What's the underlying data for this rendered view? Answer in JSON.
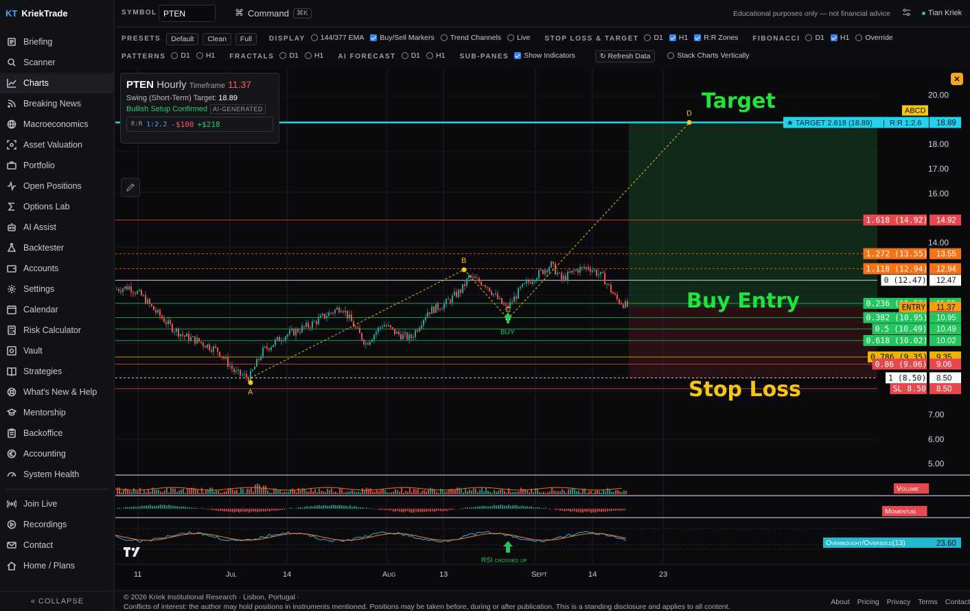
{
  "brand": {
    "logo": "KT",
    "name": "KriekTrade"
  },
  "sidebar": {
    "items": [
      {
        "label": "Briefing",
        "icon": "newspaper-icon"
      },
      {
        "label": "Scanner",
        "icon": "search-icon"
      },
      {
        "label": "Charts",
        "icon": "chart-line-icon",
        "active": true
      },
      {
        "label": "Breaking News",
        "icon": "rss-icon"
      },
      {
        "label": "Macroeconomics",
        "icon": "globe-icon"
      },
      {
        "label": "Asset Valuation",
        "icon": "scan-icon"
      },
      {
        "label": "Portfolio",
        "icon": "briefcase-icon"
      },
      {
        "label": "Open Positions",
        "icon": "pulse-icon"
      },
      {
        "label": "Options Lab",
        "icon": "sigma-icon"
      },
      {
        "label": "AI Assist",
        "icon": "robot-icon"
      },
      {
        "label": "Backtester",
        "icon": "flask-icon"
      },
      {
        "label": "Accounts",
        "icon": "wallet-icon"
      },
      {
        "label": "Settings",
        "icon": "gear-icon"
      },
      {
        "label": "Calendar",
        "icon": "calendar-icon"
      },
      {
        "label": "Risk Calculator",
        "icon": "calculator-icon"
      },
      {
        "label": "Vault",
        "icon": "vault-icon"
      },
      {
        "label": "Strategies",
        "icon": "book-icon"
      },
      {
        "label": "What's New & Help",
        "icon": "lifebuoy-icon"
      },
      {
        "label": "Mentorship",
        "icon": "graduation-cap-icon"
      },
      {
        "label": "Backoffice",
        "icon": "clipboard-icon"
      },
      {
        "label": "Accounting",
        "icon": "euro-icon"
      },
      {
        "label": "System Health",
        "icon": "gauge-icon"
      }
    ],
    "secondary": [
      {
        "label": "Join Live",
        "icon": "broadcast-icon"
      },
      {
        "label": "Recordings",
        "icon": "play-circle-icon"
      },
      {
        "label": "Contact",
        "icon": "mail-icon"
      },
      {
        "label": "Home / Plans",
        "icon": "home-icon"
      }
    ],
    "collapse_label": "« COLLAPSE"
  },
  "topbar": {
    "symbol_label": "SYMBOL",
    "symbol_value": "PTEN",
    "command_label": "Command",
    "command_shortcut": "⌘K",
    "disclaimer": "Educational purposes only — not financial advice",
    "user": "Tian Kriek"
  },
  "options": {
    "presets_label": "PRESETS",
    "presets": [
      "Default",
      "Clean",
      "Full"
    ],
    "display_label": "DISPLAY",
    "display": [
      {
        "label": "144/377 EMA",
        "checked": false
      },
      {
        "label": "Buy/Sell Markers",
        "checked": true
      },
      {
        "label": "Trend Channels",
        "checked": false
      },
      {
        "label": "Live",
        "checked": false
      }
    ],
    "sl_label": "STOP LOSS & TARGET",
    "sl": [
      {
        "label": "D1",
        "checked": false
      },
      {
        "label": "H1",
        "checked": true
      },
      {
        "label": "R:R Zones",
        "checked": true
      }
    ],
    "fib_label": "FIBONACCI",
    "fib": [
      {
        "label": "D1",
        "checked": false
      },
      {
        "label": "H1",
        "checked": true
      },
      {
        "label": "Override",
        "checked": false
      }
    ],
    "patterns_label": "PATTERNS",
    "patterns": [
      {
        "label": "D1",
        "checked": false
      },
      {
        "label": "H1",
        "checked": false
      }
    ],
    "fractals_label": "FRACTALS",
    "fractals": [
      {
        "label": "D1",
        "checked": false
      },
      {
        "label": "H1",
        "checked": false
      }
    ],
    "ai_label": "AI FORECAST",
    "ai": [
      {
        "label": "D1",
        "checked": false
      },
      {
        "label": "H1",
        "checked": false
      }
    ],
    "subpanes_label": "SUB-PANES",
    "subpanes": [
      {
        "label": "Show Indicators",
        "checked": true
      }
    ],
    "refresh_label": "↻ Refresh Data",
    "stack": {
      "label": "Stack Charts Vertically",
      "checked": false
    }
  },
  "infobox": {
    "symbol": "PTEN",
    "tf_word": "Hourly",
    "tf_label": "Timeframe",
    "price": "11.37",
    "swing_label": "Swing (Short-Term) Target:",
    "swing_value": "18.89",
    "bullish": "Bullish Setup Confirmed",
    "ai_tag": "AI-GENERATED",
    "rr_tag": "R:R",
    "rr_value": "1:2.2",
    "risk": "-$100",
    "reward": "+$218"
  },
  "annotations": {
    "target": "Target",
    "buy_entry": "Buy Entry",
    "stop_loss": "Stop Loss",
    "buy_marker": "BUY",
    "rsi": "RSI crossed up"
  },
  "chart_data": {
    "type": "candlestick",
    "ylim": [
      4.6,
      20.8
    ],
    "y_ticks": [
      "20.00",
      "18.00",
      "17.00",
      "16.00",
      "14.00",
      "7.00",
      "6.00",
      "5.00"
    ],
    "x_ticks": [
      "11",
      "Jul",
      "14",
      "Aug",
      "13",
      "Sept",
      "14",
      "23"
    ],
    "abcd_points": [
      {
        "label": "A",
        "price": 8.5
      },
      {
        "label": "B",
        "price": 12.9
      },
      {
        "label": "C",
        "price": 10.9
      },
      {
        "label": "D",
        "price": 18.89
      }
    ],
    "pattern_tag": "ABCD",
    "target_label": "★ TARGET 2.618 (18.89)",
    "target_rr": "R:R 1:2.6",
    "price_labels": [
      {
        "text": "18.89",
        "price": 18.89,
        "color": "#22d3ee"
      },
      {
        "text": "14.92",
        "price": 14.92,
        "color": "#e5484d"
      },
      {
        "text": "13.55",
        "price": 13.55,
        "color": "#f97316"
      },
      {
        "text": "12.94",
        "price": 12.94,
        "color": "#f97316"
      },
      {
        "text": "12.47",
        "price": 12.47,
        "color": "#ffffff"
      },
      {
        "text": "11.53",
        "price": 11.53,
        "color": "#22c55e"
      },
      {
        "text": "11.37",
        "price": 11.37,
        "color": "#f59e0b"
      },
      {
        "text": "11.37",
        "price": 11.0,
        "color": "#e5484d"
      },
      {
        "text": "10.95",
        "price": 10.95,
        "color": "#22c55e"
      },
      {
        "text": "10.49",
        "price": 10.49,
        "color": "#22c55e"
      },
      {
        "text": "10.02",
        "price": 10.02,
        "color": "#22c55e"
      },
      {
        "text": "9.35",
        "price": 9.35,
        "color": "#eab308"
      },
      {
        "text": "9.06",
        "price": 9.06,
        "color": "#e5484d"
      },
      {
        "text": "8.50",
        "price": 8.5,
        "color": "#ffffff"
      },
      {
        "text": "8.50",
        "price": 8.06,
        "color": "#e5484d"
      }
    ],
    "fib_levels": [
      {
        "label": "1.618 (14.92)",
        "price": 14.92,
        "color": "#e5484d"
      },
      {
        "label": "1.272 (13.55)",
        "price": 13.55,
        "color": "#f97316"
      },
      {
        "label": "1.118 (12.94)",
        "price": 12.94,
        "color": "#f97316"
      },
      {
        "label": "0 (12.47)",
        "price": 12.47,
        "color": "#ffffff"
      },
      {
        "label": "0.236 (11.53)",
        "price": 11.53,
        "color": "#22c55e"
      },
      {
        "label": "ENTRY",
        "price": 11.37,
        "color": "#f59e0b"
      },
      {
        "label": "0.382 (10.95)",
        "price": 10.95,
        "color": "#22c55e"
      },
      {
        "label": "0.5 (10.49)",
        "price": 10.49,
        "color": "#22c55e"
      },
      {
        "label": "0.618 (10.02)",
        "price": 10.02,
        "color": "#22c55e"
      },
      {
        "label": "0.786 (9.35)",
        "price": 9.35,
        "color": "#eab308"
      },
      {
        "label": "0.86 (9.06)",
        "price": 9.06,
        "color": "#e5484d"
      },
      {
        "label": "1 (8.50)",
        "price": 8.5,
        "color": "#ffffff"
      },
      {
        "label": "SL 8.50",
        "price": 8.06,
        "color": "#e5484d"
      }
    ],
    "subpanes": [
      {
        "name": "Volume",
        "color": "#e5484d"
      },
      {
        "name": "Momentum",
        "color": "#e5484d"
      },
      {
        "name": "Overbought/Oversold(13)",
        "color": "#22b8cf",
        "value": "23.60"
      }
    ]
  },
  "footer": {
    "line1": "© 2026 Kriek Institutional Research · Lisbon, Portugal ·",
    "line2": "Conflicts of interest: the author may hold positions in instruments mentioned. Positions may be taken before, during or after publication. This is a standing disclosure and applies to all content.",
    "links": [
      "About",
      "Pricing",
      "Privacy",
      "Terms",
      "Contact"
    ]
  }
}
